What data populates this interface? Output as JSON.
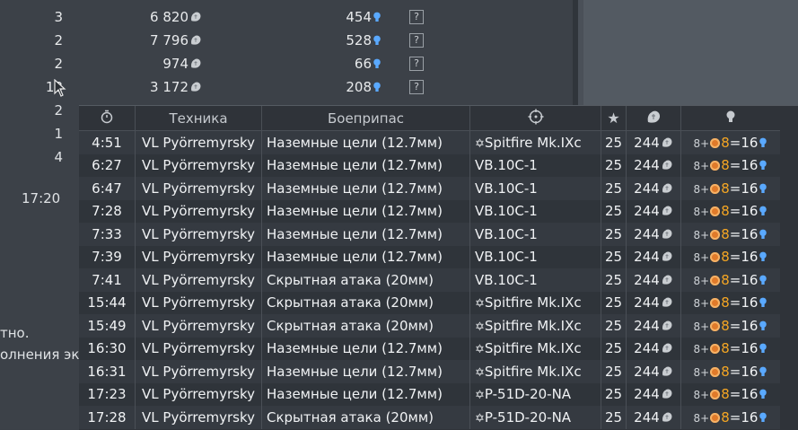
{
  "background_rows": [
    {
      "count": "3",
      "silver": "6 820",
      "rp": "454",
      "help": "?"
    },
    {
      "count": "2",
      "silver": "7 796",
      "rp": "528",
      "help": "?"
    },
    {
      "count": "2",
      "silver": "974",
      "rp": "66",
      "help": "?"
    },
    {
      "count": "13",
      "silver": "3 172",
      "rp": "208",
      "help": "?"
    }
  ],
  "background_counts_extra": [
    "2",
    "1",
    "4"
  ],
  "background_time": "17:20",
  "background_text": [
    "тно.",
    "олнения эк"
  ],
  "table": {
    "headers": {
      "time": "",
      "vehicle": "Техника",
      "ammo": "Боеприпас",
      "target": "",
      "rank": "",
      "silver": "",
      "rp": ""
    },
    "rows": [
      {
        "time": "4:51",
        "vehicle": "VL Pyörremyrsky",
        "ammo": "Наземные цели (12.7мм)",
        "target": "Spitfire Mk.IXc",
        "target_star": true,
        "rank": "25",
        "silver": "244",
        "rp_base": "8+",
        "rp_mult": "8",
        "rp_total": "=16"
      },
      {
        "time": "6:27",
        "vehicle": "VL Pyörremyrsky",
        "ammo": "Наземные цели (12.7мм)",
        "target": "VB.10C-1",
        "target_star": false,
        "rank": "25",
        "silver": "244",
        "rp_base": "8+",
        "rp_mult": "8",
        "rp_total": "=16"
      },
      {
        "time": "6:47",
        "vehicle": "VL Pyörremyrsky",
        "ammo": "Наземные цели (12.7мм)",
        "target": "VB.10C-1",
        "target_star": false,
        "rank": "25",
        "silver": "244",
        "rp_base": "8+",
        "rp_mult": "8",
        "rp_total": "=16"
      },
      {
        "time": "7:28",
        "vehicle": "VL Pyörremyrsky",
        "ammo": "Наземные цели (12.7мм)",
        "target": "VB.10C-1",
        "target_star": false,
        "rank": "25",
        "silver": "244",
        "rp_base": "8+",
        "rp_mult": "8",
        "rp_total": "=16"
      },
      {
        "time": "7:33",
        "vehicle": "VL Pyörremyrsky",
        "ammo": "Наземные цели (12.7мм)",
        "target": "VB.10C-1",
        "target_star": false,
        "rank": "25",
        "silver": "244",
        "rp_base": "8+",
        "rp_mult": "8",
        "rp_total": "=16"
      },
      {
        "time": "7:39",
        "vehicle": "VL Pyörremyrsky",
        "ammo": "Наземные цели (12.7мм)",
        "target": "VB.10C-1",
        "target_star": false,
        "rank": "25",
        "silver": "244",
        "rp_base": "8+",
        "rp_mult": "8",
        "rp_total": "=16"
      },
      {
        "time": "7:41",
        "vehicle": "VL Pyörremyrsky",
        "ammo": "Скрытная атака (20мм)",
        "target": "VB.10C-1",
        "target_star": false,
        "rank": "25",
        "silver": "244",
        "rp_base": "8+",
        "rp_mult": "8",
        "rp_total": "=16"
      },
      {
        "time": "15:44",
        "vehicle": "VL Pyörremyrsky",
        "ammo": "Скрытная атака (20мм)",
        "target": "Spitfire Mk.IXc",
        "target_star": true,
        "rank": "25",
        "silver": "244",
        "rp_base": "8+",
        "rp_mult": "8",
        "rp_total": "=16"
      },
      {
        "time": "15:49",
        "vehicle": "VL Pyörremyrsky",
        "ammo": "Скрытная атака (20мм)",
        "target": "Spitfire Mk.IXc",
        "target_star": true,
        "rank": "25",
        "silver": "244",
        "rp_base": "8+",
        "rp_mult": "8",
        "rp_total": "=16"
      },
      {
        "time": "16:30",
        "vehicle": "VL Pyörremyrsky",
        "ammo": "Наземные цели (12.7мм)",
        "target": "Spitfire Mk.IXc",
        "target_star": true,
        "rank": "25",
        "silver": "244",
        "rp_base": "8+",
        "rp_mult": "8",
        "rp_total": "=16"
      },
      {
        "time": "16:31",
        "vehicle": "VL Pyörremyrsky",
        "ammo": "Наземные цели (12.7мм)",
        "target": "Spitfire Mk.IXc",
        "target_star": true,
        "rank": "25",
        "silver": "244",
        "rp_base": "8+",
        "rp_mult": "8",
        "rp_total": "=16"
      },
      {
        "time": "17:23",
        "vehicle": "VL Pyörremyrsky",
        "ammo": "Наземные цели (12.7мм)",
        "target": "P-51D-20-NA",
        "target_star": true,
        "rank": "25",
        "silver": "244",
        "rp_base": "8+",
        "rp_mult": "8",
        "rp_total": "=16"
      },
      {
        "time": "17:28",
        "vehicle": "VL Pyörremyrsky",
        "ammo": "Скрытная атака (20мм)",
        "target": "P-51D-20-NA",
        "target_star": true,
        "rank": "25",
        "silver": "244",
        "rp_base": "8+",
        "rp_mult": "8",
        "rp_total": "=16"
      }
    ]
  },
  "icons": {
    "time_header": "stopwatch-icon",
    "target_header": "crosshair-icon",
    "rank_header": "star-icon",
    "silver_header": "silver-lion-icon",
    "rp_header": "research-bulb-icon"
  },
  "colors": {
    "rp_blue": "#5aa9ff",
    "booster_orange": "#f5a623"
  }
}
